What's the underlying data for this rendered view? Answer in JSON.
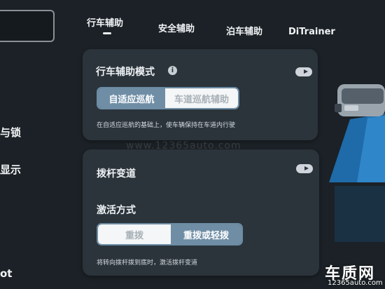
{
  "sidebar": {
    "items": [
      {
        "label": "与锁"
      },
      {
        "label": "显示"
      },
      {
        "label": "ot"
      }
    ]
  },
  "tabs": [
    {
      "label": "行车辅助",
      "active": true
    },
    {
      "label": "安全辅助",
      "active": false
    },
    {
      "label": "泊车辅助",
      "active": false
    },
    {
      "label": "DiTrainer",
      "active": false
    }
  ],
  "drive_assist_card": {
    "title": "行车辅助模式",
    "info_icon": "info-icon",
    "toggle_icon": "play-toggle-icon",
    "modes": [
      {
        "label": "自适应巡航",
        "selected": true
      },
      {
        "label": "车道巡航辅助",
        "selected": false
      }
    ],
    "description": "在自适应巡航的基础上，使车辆保持在车道内行驶"
  },
  "lane_change_card": {
    "title": "拨杆变道",
    "toggle_icon": "play-toggle-icon",
    "activation_title": "激活方式",
    "options": [
      {
        "label": "重拨",
        "selected": false
      },
      {
        "label": "重拨或轻拨",
        "selected": true
      }
    ],
    "description": "将转向拨杆拨到底时，激活拨杆变道"
  },
  "watermark": "www.12365auto.com",
  "logo": {
    "main": "车质网",
    "sub": "12365auto.com"
  },
  "colors": {
    "background": "#1b2126",
    "card": "#2b343b",
    "accent": "#6f8ea6"
  }
}
